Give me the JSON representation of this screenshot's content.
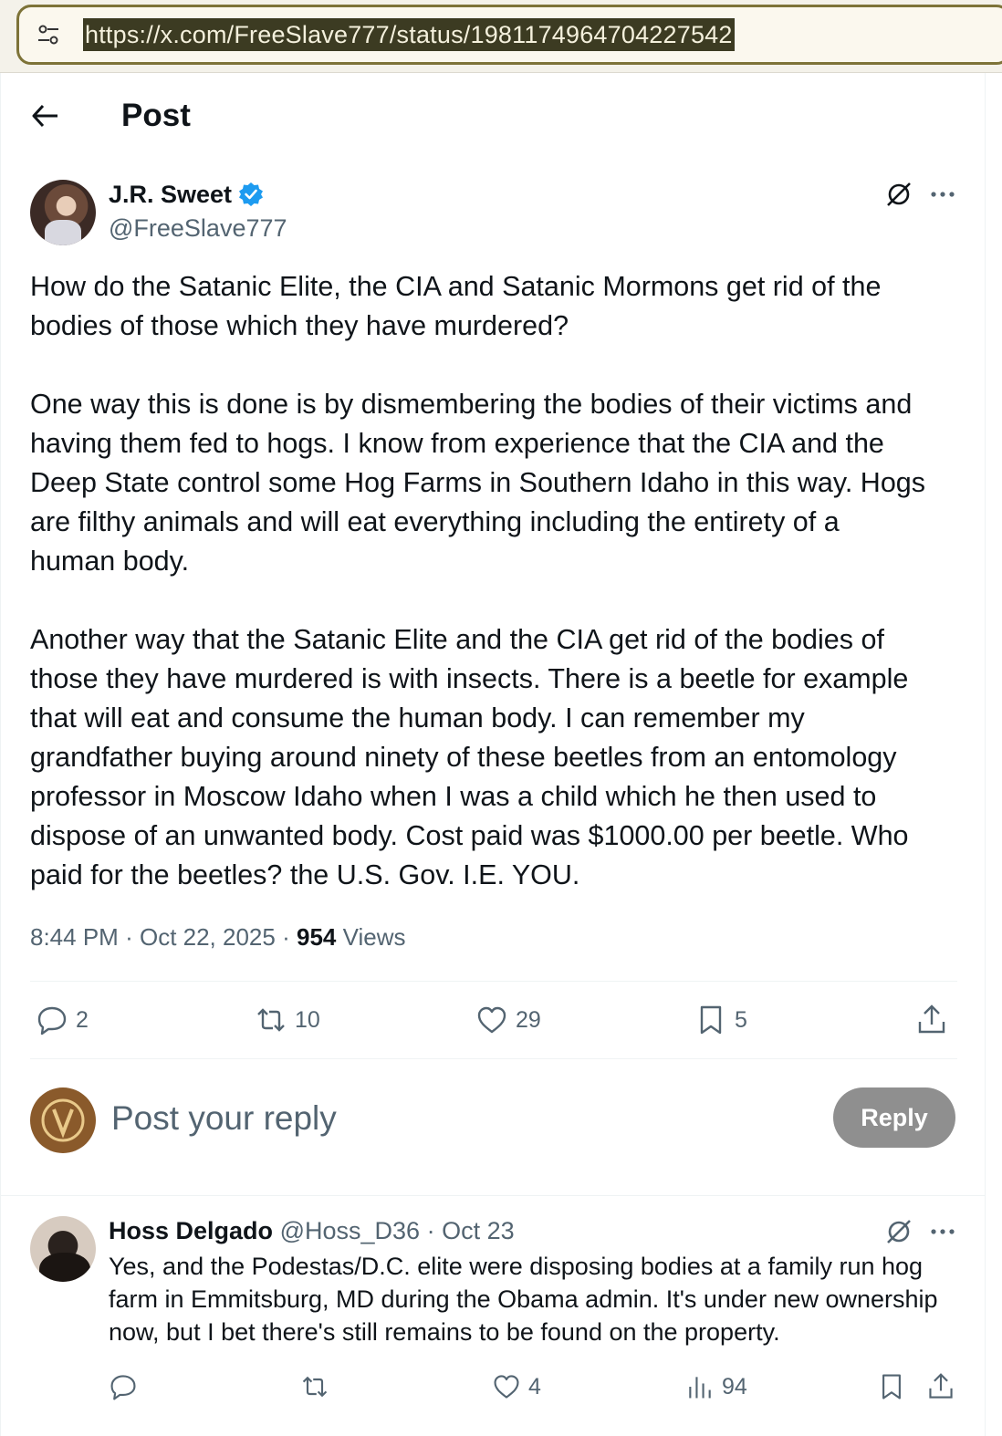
{
  "browser": {
    "url": "https://x.com/FreeSlave777/status/1981174964704227542",
    "tune_icon": "tune-icon"
  },
  "header": {
    "title": "Post",
    "back_icon": "arrow-left-icon"
  },
  "post": {
    "author_name": "J.R. Sweet",
    "author_handle": "@FreeSlave777",
    "verified": true,
    "text": "How do the Satanic Elite, the CIA and Satanic Mormons get rid of the\nbodies of those which they have murdered?\n\nOne way this is done is by dismembering the bodies of their victims and\nhaving them fed to hogs. I know from experience that the CIA and the\nDeep State control some Hog Farms in Southern Idaho in this way. Hogs\nare filthy animals and will eat everything including the entirety of a\nhuman body.\n\nAnother way that the Satanic Elite and the CIA get rid of the bodies of\nthose they have murdered is with insects. There is a beetle for example\nthat will eat and consume the human body. I can remember my\ngrandfather buying around ninety of these beetles from an entomology\nprofessor in Moscow Idaho when I was a child which he then used to\ndispose of an unwanted body. Cost paid was $1000.00 per beetle. Who\npaid for the beetles? the U.S. Gov. I.E. YOU.",
    "time": "8:44 PM",
    "separator": "·",
    "date": "Oct 22, 2025",
    "views_count": "954",
    "views_label": "Views",
    "replies": "2",
    "reposts": "10",
    "likes": "29",
    "bookmarks": "5"
  },
  "composer": {
    "placeholder": "Post your reply",
    "button_label": "Reply"
  },
  "reply": {
    "name": "Hoss Delgado",
    "handle": "@Hoss_D36",
    "dot": "·",
    "date": "Oct 23",
    "text": "Yes, and the Podestas/D.C. elite were disposing bodies at a family run hog farm in Emmitsburg, MD during the Obama admin. It's under new ownership now, but I bet there's still remains to be found on the property.",
    "likes": "4",
    "views": "94"
  },
  "colors": {
    "verified_blue": "#1d9bf0",
    "muted_text": "#536471",
    "reply_button": "#8f8f8f",
    "url_border": "#7d7338"
  }
}
